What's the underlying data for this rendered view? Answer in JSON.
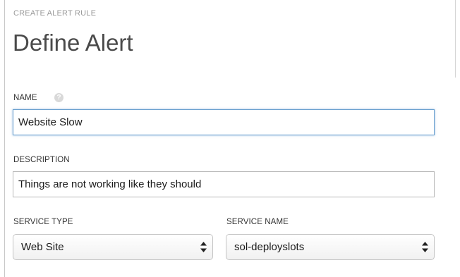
{
  "header": {
    "breadcrumb": "CREATE ALERT RULE",
    "title": "Define Alert"
  },
  "form": {
    "name": {
      "label": "NAME",
      "value": "Website Slow",
      "help_icon": "help-icon"
    },
    "description": {
      "label": "DESCRIPTION",
      "value": "Things are not working like they should"
    },
    "service_type": {
      "label": "SERVICE TYPE",
      "selected": "Web Site",
      "icon": "updown-arrows-icon"
    },
    "service_name": {
      "label": "SERVICE NAME",
      "selected": "sol-deployslots",
      "icon": "updown-arrows-icon"
    }
  },
  "colors": {
    "focus_border": "#6aa0cf",
    "title_text": "#4a4a4a",
    "muted_text": "#9a9a9a"
  }
}
